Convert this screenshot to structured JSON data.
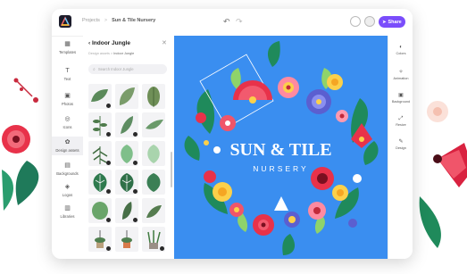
{
  "header": {
    "breadcrumb_root": "Projects",
    "breadcrumb_sep": ">",
    "project_name": "Sun & Tile Nursery",
    "undo_icon": "↶",
    "redo_icon": "↷",
    "share_label": "Share"
  },
  "leftnav": {
    "items": [
      {
        "label": "Templates",
        "icon": "▦"
      },
      {
        "label": "Text",
        "icon": "T"
      },
      {
        "label": "Photos",
        "icon": "▣"
      },
      {
        "label": "Icons",
        "icon": "◎"
      },
      {
        "label": "Design assets",
        "icon": "✿"
      },
      {
        "label": "Backgrounds",
        "icon": "▤"
      },
      {
        "label": "Logos",
        "icon": "◈"
      },
      {
        "label": "Libraries",
        "icon": "▥"
      }
    ]
  },
  "panel": {
    "title": "Indoor Jungle",
    "back_icon": "‹",
    "close_icon": "✕",
    "breadcrumb_parent": "Design assets",
    "breadcrumb_sep": ">",
    "breadcrumb_current": "Indoor Jungle",
    "search_placeholder": "Search Indoor Jungle"
  },
  "canvas": {
    "headline": "SUN & TILE",
    "subline": "NURSERY"
  },
  "rightnav": {
    "items": [
      {
        "label": "Colors",
        "icon": "◐"
      },
      {
        "label": "Animation",
        "icon": "✧"
      },
      {
        "label": "Background",
        "icon": "▣"
      },
      {
        "label": "Resize",
        "icon": "⤢"
      },
      {
        "label": "Design",
        "icon": "✎"
      }
    ]
  },
  "colors": {
    "accent": "#7a4dfb",
    "canvas_bg": "#3a8ef0",
    "flower_red": "#e8324a",
    "leaf_green": "#1f8a5b"
  }
}
